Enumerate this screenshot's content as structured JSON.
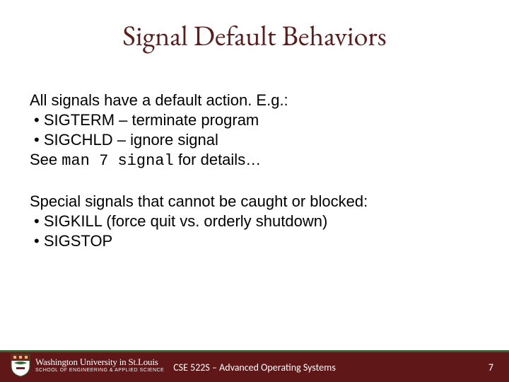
{
  "title": "Signal Default Behaviors",
  "body": {
    "p1_line1": "All signals have a default action. E.g.:",
    "p1_bullet1": "SIGTERM – terminate program",
    "p1_bullet2": "SIGCHLD – ignore signal",
    "p1_line4_a": "See ",
    "p1_line4_code": "man 7 signal",
    "p1_line4_b": " for details…",
    "p2_line1": "Special signals that cannot be caught or blocked:",
    "p2_bullet1": "SIGKILL (force quit vs. orderly shutdown)",
    "p2_bullet2": "SIGSTOP"
  },
  "footer": {
    "course": "CSE 522S – Advanced Operating Systems",
    "page": "7",
    "logo_line1": "Washington University in St.Louis",
    "logo_line2": "SCHOOL OF ENGINEERING & APPLIED SCIENCE"
  }
}
